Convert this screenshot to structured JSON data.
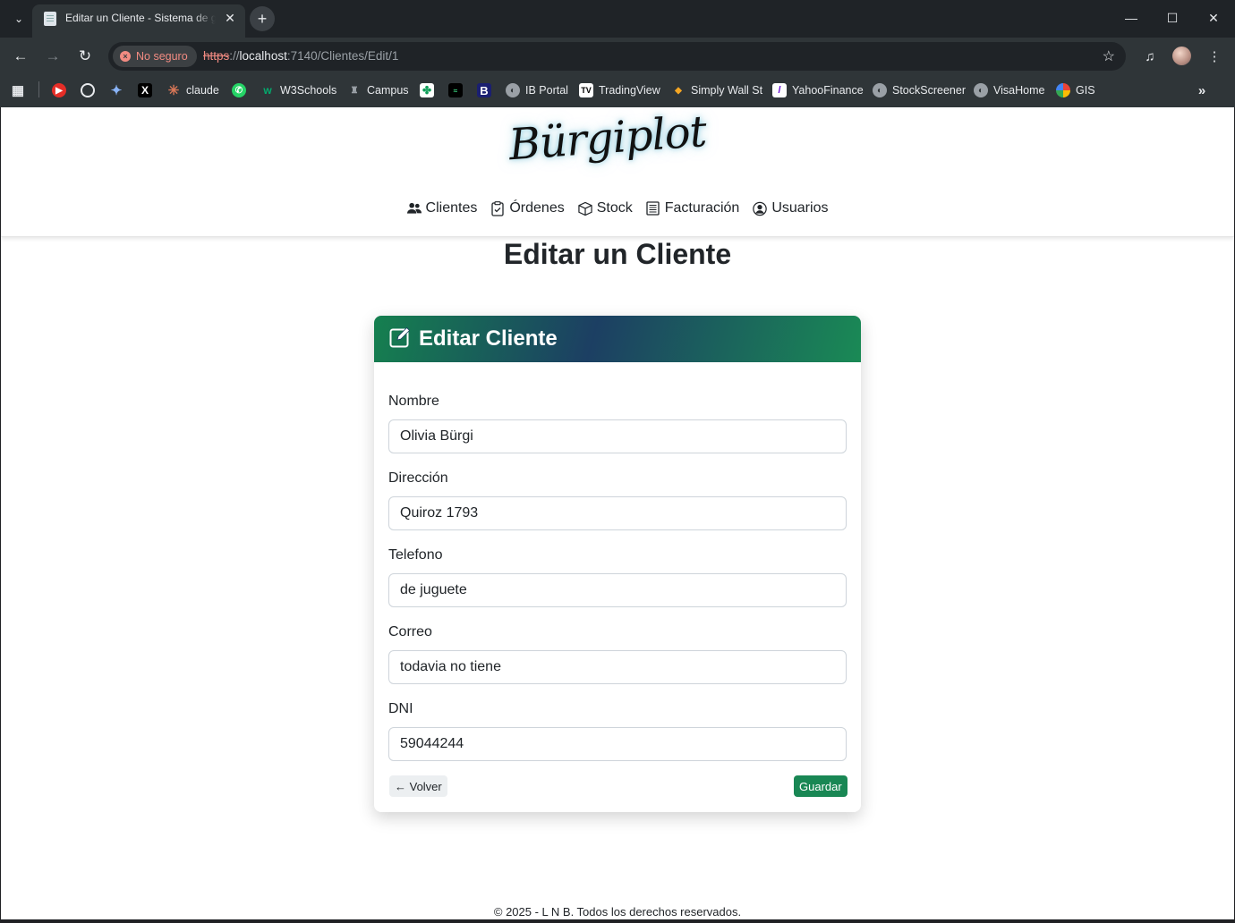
{
  "browser": {
    "tab": {
      "title": "Editar un Cliente - Sistema de g"
    },
    "security_label": "No seguro",
    "url": {
      "scheme": "https",
      "sep": "://",
      "host": "localhost",
      "path": ":7140/Clientes/Edit/1"
    },
    "bookmarks": [
      {
        "label": "",
        "icon": "youtube-music-icon"
      },
      {
        "label": "",
        "icon": "chatgpt-icon"
      },
      {
        "label": "",
        "icon": "gemini-icon"
      },
      {
        "label": "",
        "icon": "x-icon"
      },
      {
        "label": "claude",
        "icon": "claude-icon"
      },
      {
        "label": "",
        "icon": "whatsapp-icon"
      },
      {
        "label": "W3Schools",
        "icon": "w3schools-icon"
      },
      {
        "label": "Campus",
        "icon": "campus-icon"
      },
      {
        "label": "",
        "icon": "green-app-icon"
      },
      {
        "label": "",
        "icon": "terminal-icon"
      },
      {
        "label": "",
        "icon": "b-icon"
      },
      {
        "label": "IB Portal",
        "icon": "globe-icon"
      },
      {
        "label": "TradingView",
        "icon": "tradingview-icon"
      },
      {
        "label": "Simply Wall St",
        "icon": "simplywallst-icon"
      },
      {
        "label": "YahooFinance",
        "icon": "yahoo-icon"
      },
      {
        "label": "StockScreener",
        "icon": "globe-icon"
      },
      {
        "label": "VisaHome",
        "icon": "globe-icon"
      },
      {
        "label": "GIS",
        "icon": "gis-icon"
      }
    ]
  },
  "site": {
    "logo_text": "Bürgiplot",
    "nav": [
      {
        "label": "Clientes",
        "icon": "users-icon"
      },
      {
        "label": "Órdenes",
        "icon": "clipboard-check-icon"
      },
      {
        "label": "Stock",
        "icon": "box-icon"
      },
      {
        "label": "Facturación",
        "icon": "receipt-icon"
      },
      {
        "label": "Usuarios",
        "icon": "user-circle-icon"
      }
    ],
    "page_title": "Editar un Cliente",
    "footer": "© 2025 - L N B. Todos los derechos reservados."
  },
  "form": {
    "title": "Editar Cliente",
    "fields": [
      {
        "label": "Nombre",
        "value": "Olivia Bürgi"
      },
      {
        "label": "Dirección",
        "value": "Quiroz 1793"
      },
      {
        "label": "Telefono",
        "value": "de juguete"
      },
      {
        "label": "Correo",
        "value": "todavia no tiene"
      },
      {
        "label": "DNI",
        "value": "59044244"
      }
    ],
    "back_label": "← Volver",
    "save_label": "Guardar"
  },
  "colors": {
    "save_button": "#198754",
    "header_gradient": [
      "#15804f",
      "#1c3f63",
      "#1a8a55"
    ],
    "insecure": "#f28b82"
  }
}
